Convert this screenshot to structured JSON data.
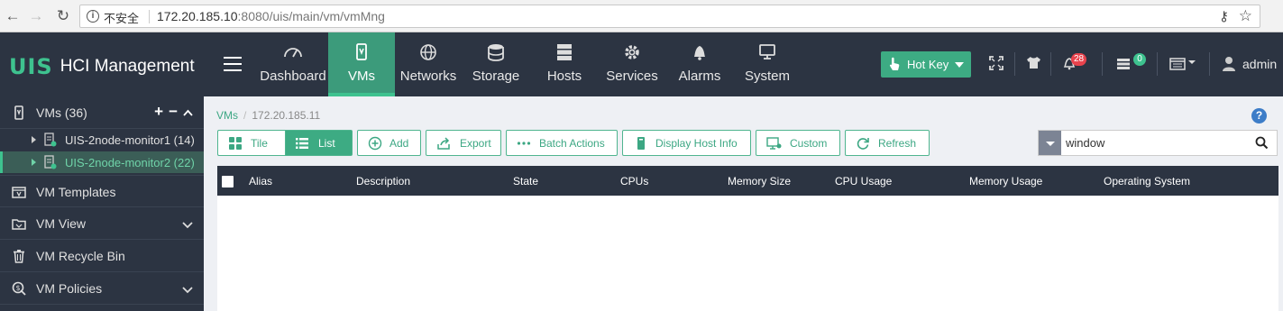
{
  "browser": {
    "security_label": "不安全",
    "url_host": "172.20.185.10",
    "url_rest": ":8080/uis/main/vm/vmMng"
  },
  "app": {
    "logo_mark": "UIS",
    "logo_text": "HCI Management"
  },
  "nav": {
    "items": [
      {
        "label": "Dashboard",
        "icon": "gauge-icon"
      },
      {
        "label": "VMs",
        "icon": "vm-icon",
        "active": true
      },
      {
        "label": "Networks",
        "icon": "globe-icon"
      },
      {
        "label": "Storage",
        "icon": "database-icon"
      },
      {
        "label": "Hosts",
        "icon": "server-icon"
      },
      {
        "label": "Services",
        "icon": "gear-icon"
      },
      {
        "label": "Alarms",
        "icon": "bell-icon"
      },
      {
        "label": "System",
        "icon": "monitor-icon"
      }
    ],
    "hotkey_label": "Hot Key",
    "alarm_count": "28",
    "task_count": "0",
    "user": "admin"
  },
  "sidebar": {
    "vms_label": "VMs (36)",
    "add": "+",
    "remove": "−",
    "clusters": [
      {
        "label": "UIS-2node-monitor1 (14)",
        "selected": false
      },
      {
        "label": "UIS-2node-monitor2 (22)",
        "selected": true
      }
    ],
    "items": [
      {
        "label": "VM Templates",
        "icon": "template-icon",
        "expandable": false
      },
      {
        "label": "VM View",
        "icon": "folder-icon",
        "expandable": true
      },
      {
        "label": "VM Recycle Bin",
        "icon": "trash-icon",
        "expandable": false
      },
      {
        "label": "VM Policies",
        "icon": "policy-icon",
        "expandable": true
      }
    ]
  },
  "main": {
    "breadcrumb": {
      "root": "VMs",
      "current": "172.20.185.11"
    },
    "toolbar": {
      "tile": "Tile",
      "list": "List",
      "add": "Add",
      "export": "Export",
      "batch": "Batch Actions",
      "host_info": "Display Host Info",
      "custom": "Custom",
      "refresh": "Refresh"
    },
    "search": {
      "value": "window",
      "placeholder": ""
    },
    "table": {
      "columns": [
        "Alias",
        "Description",
        "State",
        "CPUs",
        "Memory Size",
        "CPU Usage",
        "Memory Usage",
        "Operating System"
      ],
      "rows": []
    }
  },
  "colors": {
    "accent": "#3dab83",
    "header_bg": "#2c3442",
    "alarm_badge": "#e8434d"
  }
}
